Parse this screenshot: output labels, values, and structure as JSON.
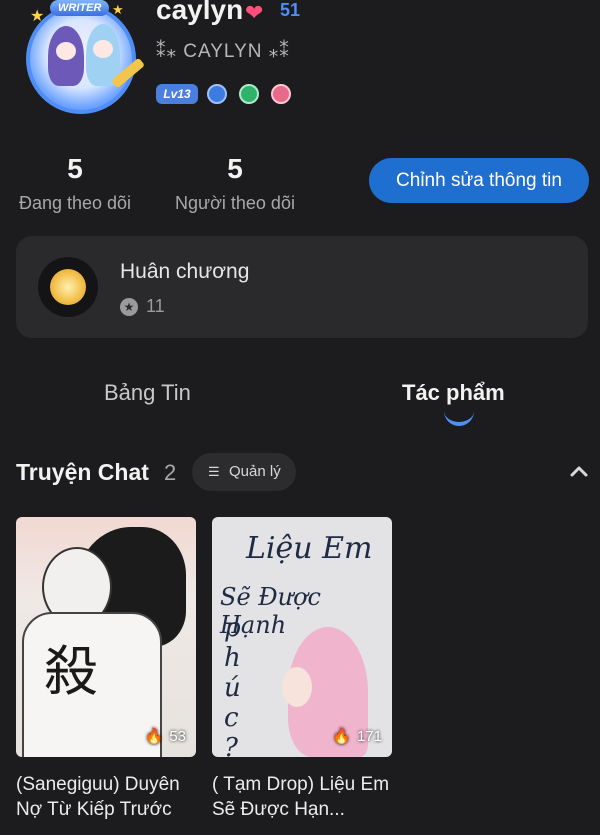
{
  "profile": {
    "username": "caylyn",
    "level_count": "51",
    "subtitle": "⁑⁎ CAYLYN ⁎⁑",
    "level_badge": "Lv13",
    "avatar_tag": "WRITER"
  },
  "stats": {
    "following_count": "5",
    "following_label": "Đang theo dõi",
    "followers_count": "5",
    "followers_label": "Người theo dõi"
  },
  "edit_button": "Chỉnh sửa thông tin",
  "medals": {
    "title": "Huân chương",
    "count": "11"
  },
  "tabs": [
    {
      "label": "Bảng Tin",
      "active": false
    },
    {
      "label": "Tác phẩm",
      "active": true
    }
  ],
  "section": {
    "title": "Truyện Chat",
    "count": "2",
    "manage_label": "Quản lý"
  },
  "stories": [
    {
      "title": "(Sanegiguu) Duyên Nợ Từ Kiếp Trước",
      "views": "53",
      "cover_text": "殺"
    },
    {
      "title": "( Tạm Drop) Liệu Em Sẽ Được Hạn...",
      "views": "171",
      "cover_lines": [
        "Liệu Em",
        "Sẽ Được Hạnh",
        "p h ú c ?"
      ]
    }
  ],
  "colors": {
    "background": "#1c1c1e",
    "accent": "#1f6fd0",
    "card": "#2a2a2c"
  }
}
